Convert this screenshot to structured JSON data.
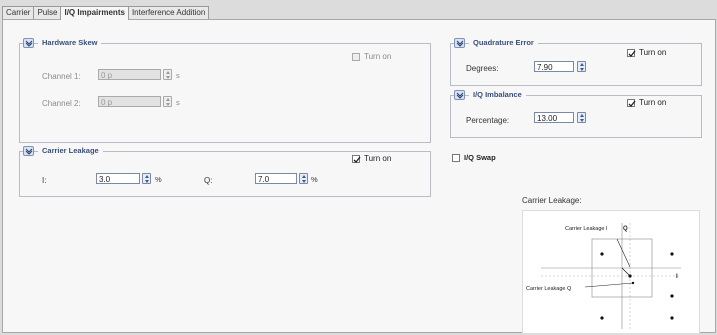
{
  "tabs": [
    "Carrier",
    "Pulse",
    "I/Q Impairments",
    "Interference Addition"
  ],
  "active_tab": "I/Q Impairments",
  "hardware_skew": {
    "title": "Hardware Skew",
    "turn_on_label": "Turn on",
    "turn_on_checked": false,
    "enabled": false,
    "channel1": {
      "label": "Channel 1:",
      "value": "0 p",
      "unit": "s"
    },
    "channel2": {
      "label": "Channel 2:",
      "value": "0 p",
      "unit": "s"
    }
  },
  "carrier_leakage": {
    "title": "Carrier Leakage",
    "turn_on_label": "Turn on",
    "turn_on_checked": true,
    "i": {
      "label": "I:",
      "value": "3.0",
      "unit": "%"
    },
    "q": {
      "label": "Q:",
      "value": "7.0",
      "unit": "%"
    }
  },
  "quadrature_error": {
    "title": "Quadrature Error",
    "turn_on_label": "Turn on",
    "turn_on_checked": true,
    "degrees": {
      "label": "Degrees:",
      "value": "7.90"
    }
  },
  "iq_imbalance": {
    "title": "I/Q Imbalance",
    "turn_on_label": "Turn on",
    "turn_on_checked": true,
    "percentage": {
      "label": "Percentage:",
      "value": "13.00"
    }
  },
  "iq_swap": {
    "label": "I/Q Swap",
    "checked": false
  },
  "diagram": {
    "title": "Carrier Leakage:",
    "label_i_q": "Carrier Leakage I",
    "q_axis": "Q",
    "label_q": "Carrier Leakage Q",
    "i_axis": "I"
  }
}
